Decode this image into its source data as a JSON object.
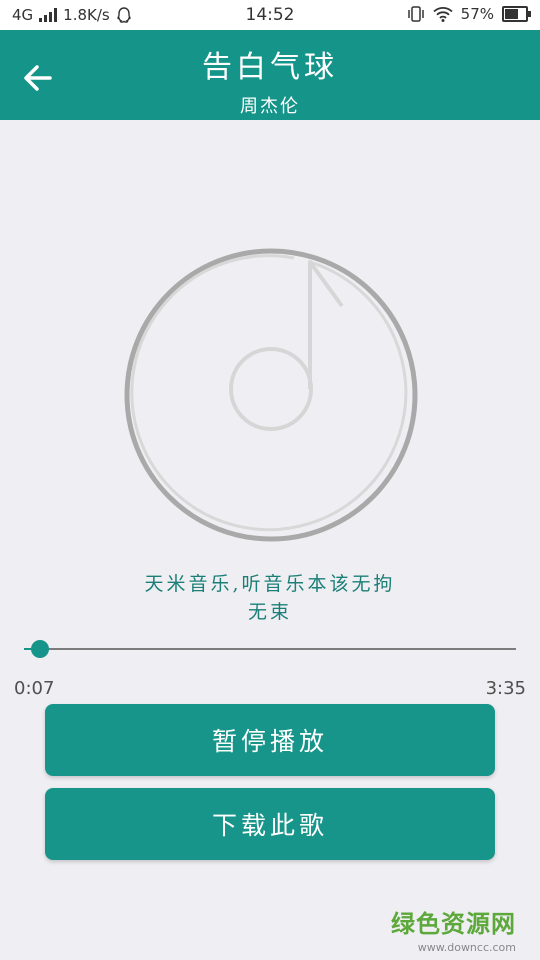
{
  "status_bar": {
    "network": "4G",
    "speed": "1.8K/s",
    "time": "14:52",
    "battery": "57%"
  },
  "header": {
    "title": "告白气球",
    "artist": "周杰伦"
  },
  "player": {
    "tagline_line1": "天米音乐,听音乐本该无拘",
    "tagline_line2": "无束",
    "elapsed": "0:07",
    "total": "3:35",
    "progress_fraction": 0.033
  },
  "buttons": {
    "pause": "暂停播放",
    "download": "下载此歌"
  },
  "watermark": {
    "main": "绿色资源网",
    "url": "www.downcc.com"
  },
  "colors": {
    "primary": "#15948a",
    "background": "#efeff3"
  },
  "icons": {
    "back": "arrow-left-icon",
    "disc": "music-note-icon"
  }
}
